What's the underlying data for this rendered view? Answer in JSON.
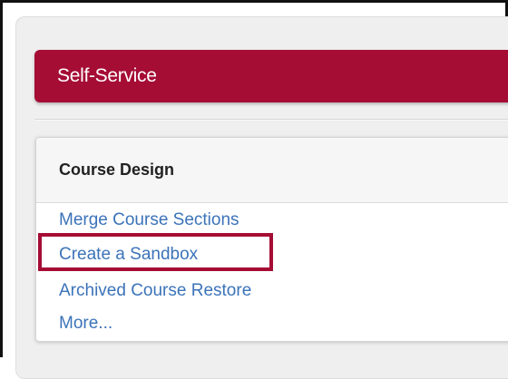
{
  "self_service": {
    "label": "Self-Service"
  },
  "course_design": {
    "title": "Course Design",
    "links": [
      {
        "label": "Merge Course Sections"
      },
      {
        "label": "Create a Sandbox"
      },
      {
        "label": "Archived Course Restore"
      },
      {
        "label": "More..."
      }
    ]
  },
  "colors": {
    "brand": "#a50d35",
    "link": "#3b73b9",
    "highlight": "#a50d35"
  }
}
